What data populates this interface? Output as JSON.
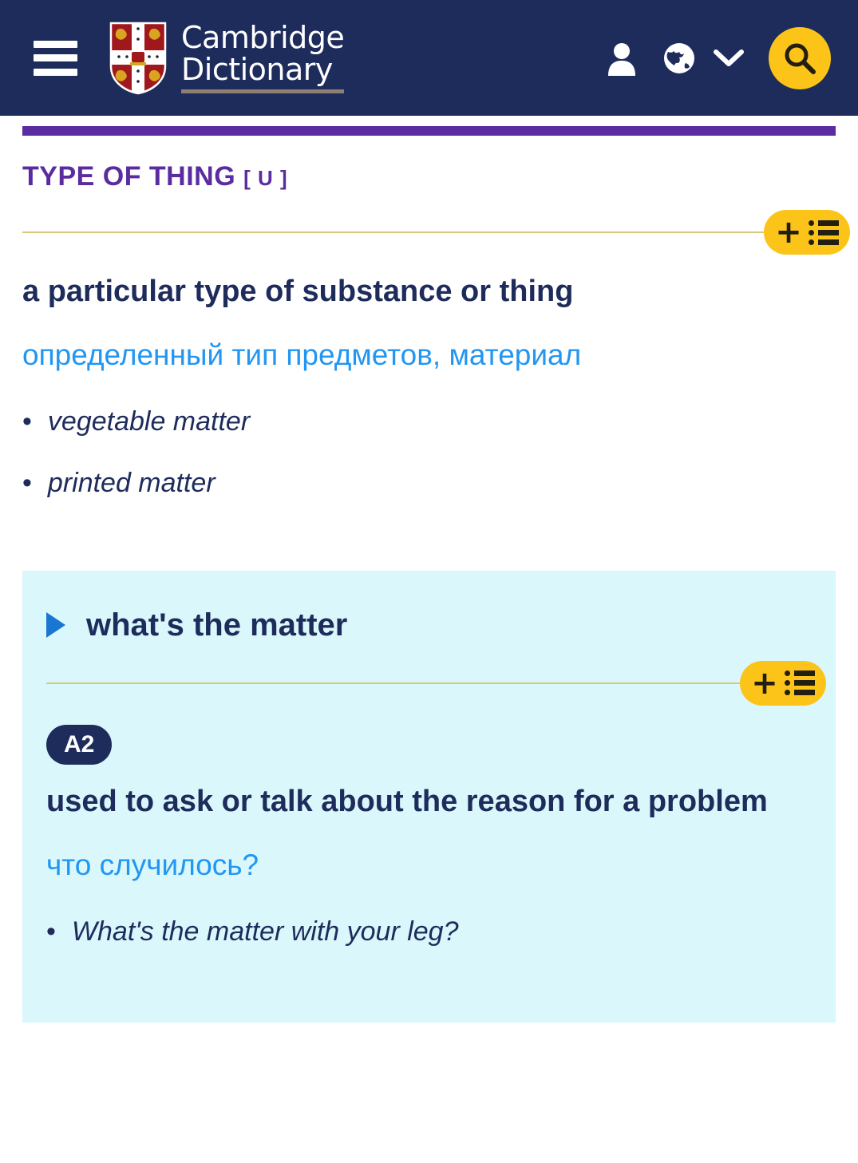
{
  "header": {
    "menu_label": "Menu",
    "brand_line1": "Cambridge",
    "brand_line2": "Dictionary",
    "account_icon": "user-icon",
    "language_icon": "globe-icon",
    "language_chevron_icon": "chevron-down-icon",
    "search_icon": "search-icon"
  },
  "entry": {
    "pos_header": "TYPE OF THING",
    "pos_gram": "[ U ]",
    "add_to_wordlist_label": "+",
    "definition": "a particular type of substance or thing",
    "translation": "определенный тип предметов, материал",
    "examples": [
      "vegetable matter",
      "printed matter"
    ],
    "bullet": "•"
  },
  "idiom": {
    "title": "what's the matter",
    "level": "A2",
    "definition": "used to ask or talk about the reason for a problem",
    "translation": "что случилось?",
    "examples": [
      "What's the matter with your leg?"
    ],
    "bullet": "•",
    "add_to_wordlist_label": "+"
  },
  "colors": {
    "header_bg": "#1E2C5C",
    "accent_purple": "#5A2CA0",
    "accent_yellow": "#FCC419",
    "translation_blue": "#2196F3",
    "panel_bg": "#DAF7FC",
    "divider_gold": "#D6C97A"
  }
}
